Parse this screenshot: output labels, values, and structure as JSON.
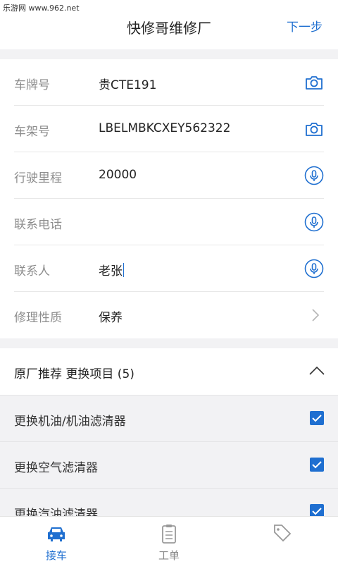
{
  "statusbar": {
    "watermark": "乐游网 www.962.net"
  },
  "header": {
    "title": "快修哥维修厂",
    "next_label": "下一步"
  },
  "form": {
    "rows": [
      {
        "label": "车牌号",
        "value": "贵CTE191",
        "icon": "camera-icon"
      },
      {
        "label": "车架号",
        "value": "LBELMBKCXEY562322",
        "icon": "camera-icon"
      },
      {
        "label": "行驶里程",
        "value": "20000",
        "icon": "microphone-icon"
      },
      {
        "label": "联系电话",
        "value": "",
        "icon": "microphone-icon"
      },
      {
        "label": "联系人",
        "value": "老张",
        "icon": "microphone-icon"
      },
      {
        "label": "修理性质",
        "value": "保养",
        "icon": "chevron-right-icon"
      }
    ]
  },
  "section": {
    "title": "原厂推荐 更换项目 (5)"
  },
  "items": [
    {
      "label": "更换机油/机油滤清器",
      "checked": true
    },
    {
      "label": "更换空气滤清器",
      "checked": true
    },
    {
      "label": "更换汽油滤清器",
      "checked": true
    }
  ],
  "tabs": [
    {
      "label": "接车",
      "active": true,
      "icon": "car-icon"
    },
    {
      "label": "工单",
      "active": false,
      "icon": "clipboard-icon"
    },
    {
      "label": "",
      "active": false,
      "icon": "tag-icon"
    }
  ],
  "colors": {
    "accent": "#1f6fd0",
    "background": "#f2f2f4"
  }
}
